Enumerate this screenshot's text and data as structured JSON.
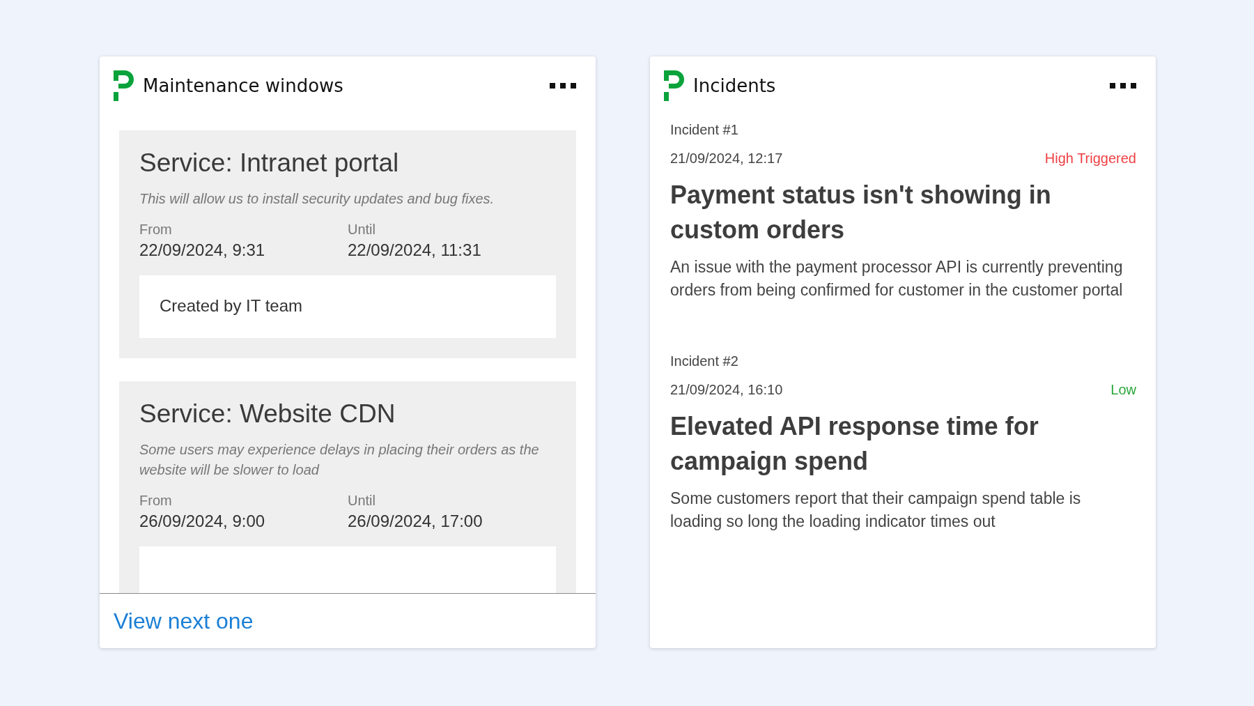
{
  "maintenance": {
    "title": "Maintenance windows",
    "windows": [
      {
        "service": "Service: Intranet portal",
        "description": "This will allow us to install security updates and bug fixes.",
        "from_label": "From",
        "from": "22/09/2024, 9:31",
        "until_label": "Until",
        "until": "22/09/2024, 11:31",
        "note": "Created by IT team"
      },
      {
        "service": "Service: Website CDN",
        "description": "Some users may experience delays in placing their orders as the website will be slower to load",
        "from_label": "From",
        "from": "26/09/2024, 9:00",
        "until_label": "Until",
        "until": "26/09/2024, 17:00"
      }
    ],
    "footer_link": "View next one"
  },
  "incidents": {
    "title": "Incidents",
    "items": [
      {
        "number": "Incident #1",
        "time": "21/09/2024, 12:17",
        "severity": "High Triggered",
        "color": "#ee3f43",
        "title": "Payment status isn't showing in custom orders",
        "description": "An issue with the payment processor API is currently preventing orders from being confirmed for customer in the customer portal"
      },
      {
        "number": "Incident #2",
        "time": "21/09/2024, 16:10",
        "severity": "Low",
        "color": "#2aa63a",
        "title": "Elevated API response time for campaign spend",
        "description": "Some customers report that their campaign spend table is loading so long the loading indicator times out"
      }
    ]
  }
}
